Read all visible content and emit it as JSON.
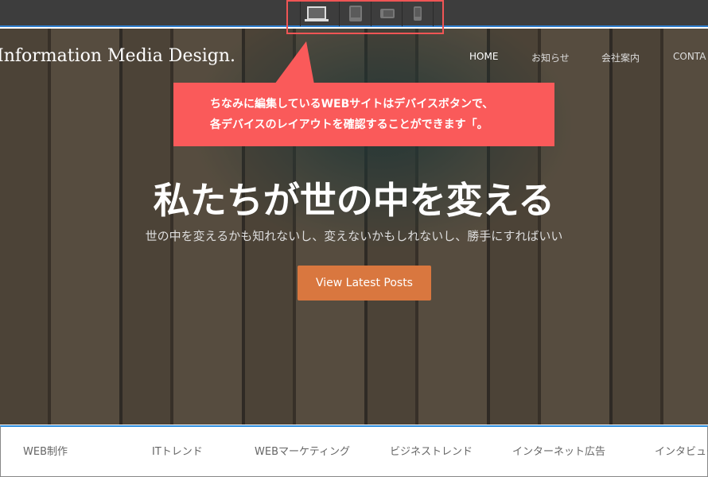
{
  "device_toolbar": {
    "buttons": [
      "laptop-icon",
      "tablet-icon",
      "tablet-landscape-icon",
      "phone-icon"
    ],
    "active": "laptop"
  },
  "site": {
    "brand": "Information Media Design.",
    "nav": [
      "HOME",
      "お知らせ",
      "会社案内",
      "CONTA"
    ],
    "hero_title": "私たちが世の中を変える",
    "hero_subtitle": "世の中を変えるかも知れないし、変えないかもしれないし、勝手にすればいい",
    "cta": "View Latest Posts",
    "categories": [
      "WEB制作",
      "ITトレンド",
      "WEBマーケティング",
      "ビジネストレンド",
      "インターネット広告",
      "インタビュー"
    ]
  },
  "callout": {
    "line1": "ちなみに編集しているWEBサイトはデバイスボタンで、",
    "line2": "各デバイスのレイアウトを確認することができます「。",
    "color": "#fa5a5a"
  }
}
